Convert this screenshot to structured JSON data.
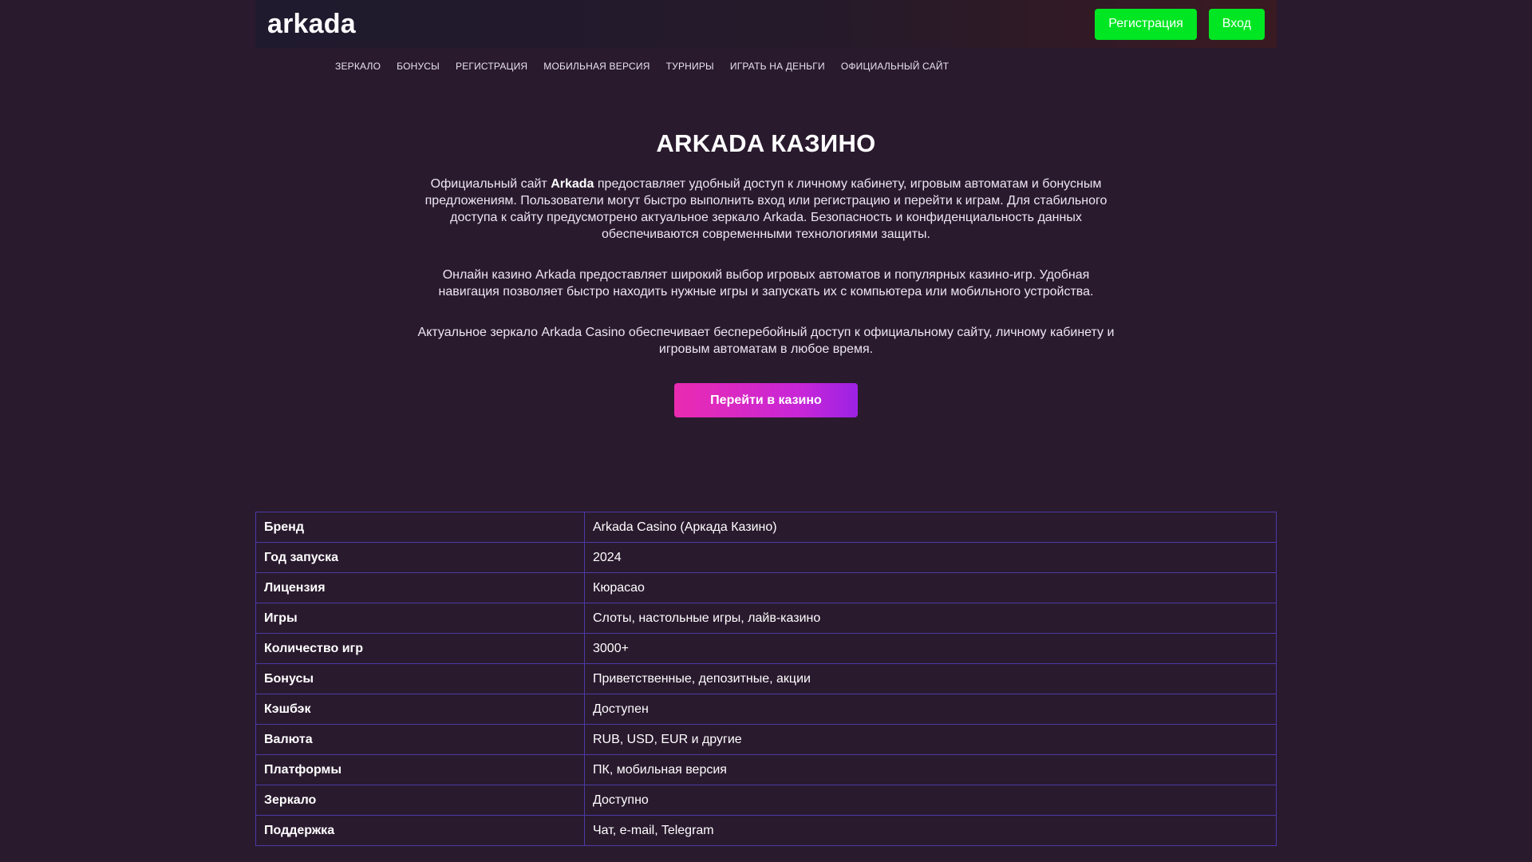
{
  "header": {
    "logo": "arkada",
    "register_label": "Регистрация",
    "login_label": "Вход"
  },
  "nav": {
    "items": [
      {
        "label": "ЗЕРКАЛО"
      },
      {
        "label": "БОНУСЫ"
      },
      {
        "label": "РЕГИСТРАЦИЯ"
      },
      {
        "label": "МОБИЛЬНАЯ ВЕРСИЯ"
      },
      {
        "label": "ТУРНИРЫ"
      },
      {
        "label": "ИГРАТЬ НА ДЕНЬГИ"
      },
      {
        "label": "ОФИЦИАЛЬНЫЙ САЙТ"
      }
    ]
  },
  "hero": {
    "title": "ARKADA КАЗИНО",
    "p1_before": "Официальный сайт ",
    "p1_brand": "Arkada",
    "p1_after": " предоставляет удобный доступ к личному кабинету, игровым автоматам и бонусным предложениям. Пользователи могут быстро выполнить вход или регистрацию и перейти к играм. Для стабильного доступа к сайту предусмотрено актуальное зеркало Arkada. Безопасность и конфиденциальность данных обеспечиваются современными технологиями защиты.",
    "p2": "Онлайн казино Arkada предоставляет широкий выбор игровых автоматов и популярных казино-игр. Удобная навигация позволяет быстро находить нужные игры и запускать их с компьютера или мобильного устройства.",
    "p3": "Актуальное зеркало Arkada Casino обеспечивает бесперебойный доступ к официальному сайту, личному кабинету и игровым автоматам в любое время.",
    "cta_label": "Перейти в казино"
  },
  "info": {
    "rows": [
      {
        "key": "Бренд",
        "value": "Arkada Casino (Аркада Казино)"
      },
      {
        "key": "Год запуска",
        "value": "2024"
      },
      {
        "key": "Лицензия",
        "value": "Кюрасао"
      },
      {
        "key": "Игры",
        "value": "Слоты, настольные игры, лайв-казино"
      },
      {
        "key": "Количество игр",
        "value": "3000+"
      },
      {
        "key": "Бонусы",
        "value": "Приветственные, депозитные, акции"
      },
      {
        "key": "Кэшбэк",
        "value": "Доступен"
      },
      {
        "key": "Валюта",
        "value": "RUB, USD, EUR и другие"
      },
      {
        "key": "Платформы",
        "value": "ПК, мобильная версия"
      },
      {
        "key": "Зеркало",
        "value": "Доступно"
      },
      {
        "key": "Поддержка",
        "value": "Чат, e-mail, Telegram"
      }
    ]
  },
  "colors": {
    "background": "#2a1a2e",
    "accent_green": "#00e622",
    "cta_start": "#ea2bb1",
    "cta_end": "#9c22e4",
    "table_border": "#4a3aa6"
  }
}
